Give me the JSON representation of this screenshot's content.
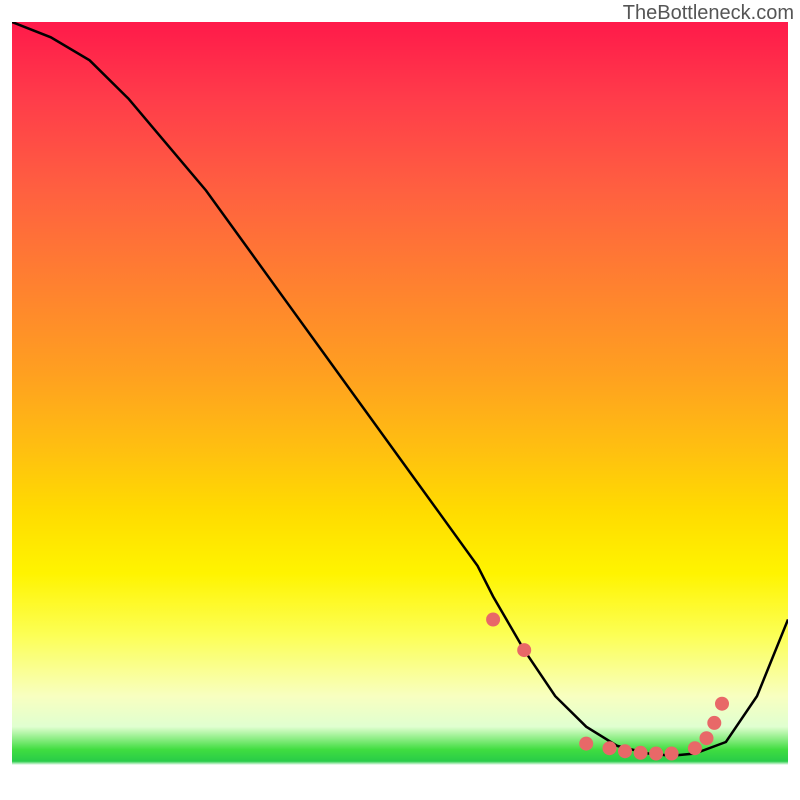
{
  "watermark": "TheBottleneck.com",
  "chart_data": {
    "type": "line",
    "title": "",
    "xlabel": "",
    "ylabel": "",
    "xlim": [
      0,
      100
    ],
    "ylim": [
      0,
      100
    ],
    "x": [
      0,
      5,
      10,
      15,
      20,
      25,
      30,
      35,
      40,
      45,
      50,
      55,
      60,
      62,
      66,
      70,
      74,
      78,
      82,
      85,
      88,
      92,
      96,
      100
    ],
    "values": [
      100,
      98,
      95,
      90,
      84,
      78,
      71,
      64,
      57,
      50,
      43,
      36,
      29,
      25,
      18,
      12,
      8,
      5.5,
      4.5,
      4.2,
      4.5,
      6,
      12,
      22
    ],
    "markers": {
      "x": [
        62,
        66,
        74,
        77,
        79,
        81,
        83,
        85,
        88,
        89.5,
        90.5,
        91.5
      ],
      "y": [
        22,
        18,
        5.8,
        5.2,
        4.8,
        4.6,
        4.5,
        4.5,
        5.2,
        6.5,
        8.5,
        11
      ]
    },
    "gradient_stops": [
      {
        "pos": 0,
        "color": "#ff1a4a"
      },
      {
        "pos": 10,
        "color": "#ff3c4a"
      },
      {
        "pos": 22,
        "color": "#ff6040"
      },
      {
        "pos": 34,
        "color": "#ff8030"
      },
      {
        "pos": 46,
        "color": "#ffa020"
      },
      {
        "pos": 56,
        "color": "#ffc010"
      },
      {
        "pos": 64,
        "color": "#ffdc00"
      },
      {
        "pos": 72,
        "color": "#fff400"
      },
      {
        "pos": 80,
        "color": "#fcff55"
      },
      {
        "pos": 88,
        "color": "#f8ffc0"
      },
      {
        "pos": 92,
        "color": "#e0ffd0"
      },
      {
        "pos": 95,
        "color": "#40dd40"
      },
      {
        "pos": 96.5,
        "color": "#28cc48"
      },
      {
        "pos": 97,
        "color": "#ffffff"
      }
    ],
    "marker_color": "#e86868",
    "line_color": "#000000"
  }
}
